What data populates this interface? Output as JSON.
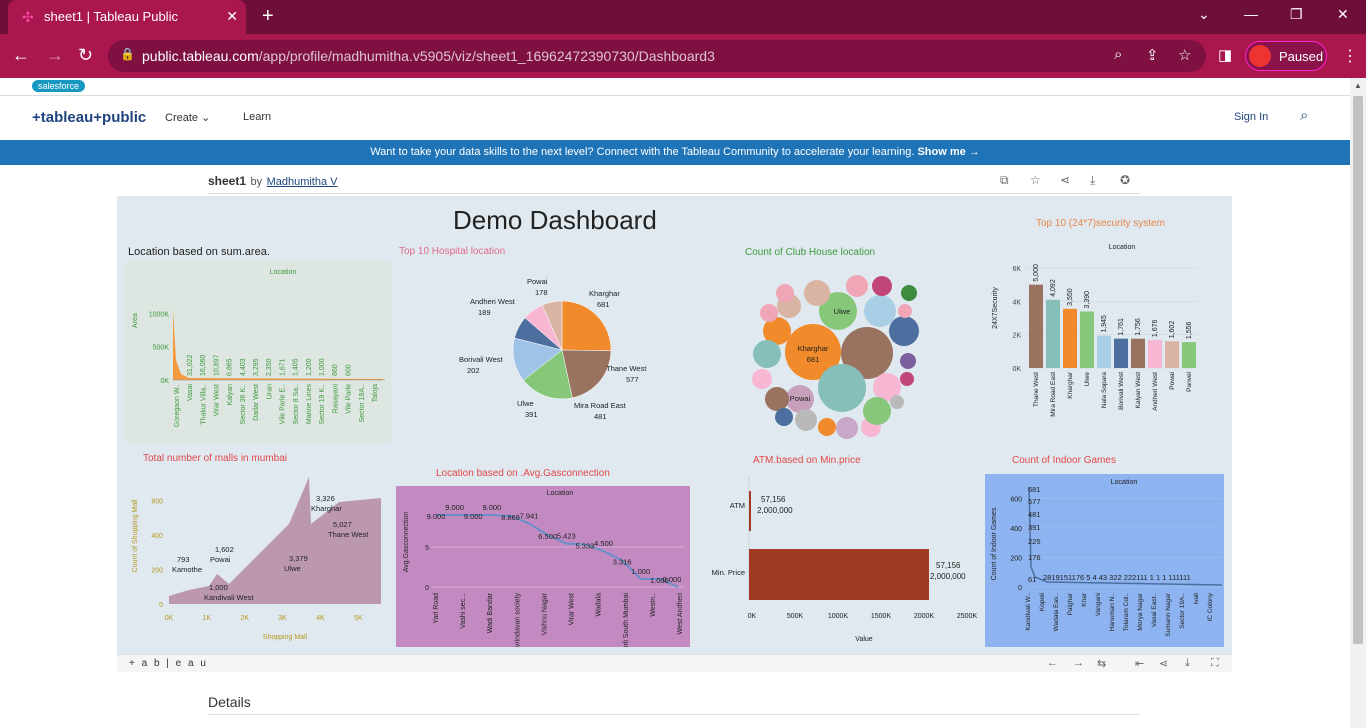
{
  "browser": {
    "tab_title": "sheet1 | Tableau Public",
    "url_host": "public.tableau.com",
    "url_path": "/app/profile/madhumitha.v5905/viz/sheet1_16962472390730/Dashboard3",
    "profile_label": "Paused",
    "bookmark": "salesforce"
  },
  "site": {
    "logo": "+tableau+public",
    "nav": [
      "Create",
      "Learn"
    ],
    "signin": "Sign In",
    "banner_text": "Want to take your data skills to the next level? Connect with the Tableau Community to accelerate your learning. ",
    "banner_link": "Show me →"
  },
  "viz": {
    "sheet_name": "sheet1",
    "by": "by",
    "author": "Madhumitha V",
    "footer_logo": "+ a b | e a u",
    "details": "Details"
  },
  "dashboard": {
    "title": "Demo Dashboard",
    "titles": {
      "area": "Location based on sum.area.",
      "hospital": "Top 10 Hospital location",
      "club": "Count of Club House location",
      "security": "Top 10 (24*7)security system",
      "malls": "Total number of malls in mumbai",
      "gas": "Location based on .Avg.Gasconnection",
      "atm": "ATM.based on Min.price",
      "indoor": "Count of Indoor Games"
    }
  },
  "colors": {
    "tab_bg": "#6e0f3a",
    "addr_bg": "#a9174e",
    "banner": "#1f74b8",
    "dash_bg": "#e0e9ef"
  },
  "chart_data": [
    {
      "type": "area",
      "title": "Location based on sum.area.",
      "header": "Location",
      "ylabel": "Area",
      "yticks": [
        "1000K",
        "500K",
        "0K"
      ],
      "categories": [
        "Goregaon W..",
        "Vasai",
        "Thakur Villa..",
        "Virar West",
        "Kalyan",
        "Sector 36 K..",
        "Dadar West",
        "Uran",
        "Vile Parle E..",
        "Sector 8 Sa..",
        "Marine Lines",
        "Sector 19 K..",
        "Rasayani",
        "Vile Parle",
        "Sector 19A..",
        "Taloja"
      ],
      "values": [
        31022,
        16060,
        10897,
        6865,
        4403,
        3295,
        2350,
        1671,
        1405,
        1200,
        1000,
        860,
        600
      ],
      "value_labels": [
        "31,022",
        "16,060",
        "10,897",
        "6,865",
        "4,403",
        "3,295",
        "2,350",
        "1,671",
        "1,405",
        "1,200",
        "1,000",
        "860",
        "600"
      ]
    },
    {
      "type": "pie",
      "title": "Top 10 Hospital location",
      "slices": [
        {
          "label": "Kharghar",
          "value": 681
        },
        {
          "label": "Thane West",
          "value": 577
        },
        {
          "label": "Mira Road East",
          "value": 481
        },
        {
          "label": "Ulwe",
          "value": 391
        },
        {
          "label": "Borivali West",
          "value": 202
        },
        {
          "label": "Andheri West",
          "value": 189
        },
        {
          "label": "Powai",
          "value": 178
        }
      ],
      "slice_labels": [
        {
          "name": "Kharghar",
          "val": "681"
        },
        {
          "name": "Thane West",
          "val": "577"
        },
        {
          "name": "Mira Road East",
          "val": "481"
        },
        {
          "name": "Ulwe",
          "val": "391"
        },
        {
          "name": "Borivali West",
          "val": "202"
        },
        {
          "name": "Andheri West",
          "val": "189"
        },
        {
          "name": "Powai",
          "val": "178"
        }
      ]
    },
    {
      "type": "bubble",
      "title": "Count of Club House location",
      "labels": [
        {
          "name": "Kharghar",
          "val": "681"
        },
        {
          "name": "Ulwe",
          "val": ""
        },
        {
          "name": "Powai",
          "val": ""
        }
      ]
    },
    {
      "type": "bar",
      "title": "Top 10 (24*7)security system",
      "header": "Location",
      "ylabel": "24X7Security",
      "yticks": [
        "6K",
        "4K",
        "2K",
        "0K"
      ],
      "categories": [
        "Thane West",
        "Mira Road East",
        "Kharghar",
        "Ulwe",
        "Nala Sopara",
        "Borivali West",
        "Kalyan West",
        "Andheri West",
        "Powai",
        "Panvel"
      ],
      "values": [
        5000,
        4092,
        3550,
        3390,
        1945,
        1761,
        1756,
        1676,
        1602,
        1556
      ],
      "value_labels": [
        "5,000",
        "4,092",
        "3,550",
        "3,390",
        "1,945",
        "1,761",
        "1,756",
        "1,676",
        "1,602",
        "1,556"
      ]
    },
    {
      "type": "area",
      "title": "Total number of malls in mumbai",
      "xlabel": "Shopping Mall",
      "ylabel": "Count of Shopping Mall",
      "xticks": [
        "0K",
        "1K",
        "2K",
        "3K",
        "4K",
        "5K"
      ],
      "yticks": [
        "600",
        "400",
        "200",
        "0"
      ],
      "annotations": [
        {
          "v": "793",
          "name": "Kamothe"
        },
        {
          "v": "1,602",
          "name": "Powai"
        },
        {
          "v": "1,000",
          "name": "Kandivali West"
        },
        {
          "v": "3,326",
          "name": "Kharghar"
        },
        {
          "v": "3,379",
          "name": "Ulwe"
        },
        {
          "v": "5,027",
          "name": "Thane West"
        }
      ]
    },
    {
      "type": "line",
      "title": "Location based on .Avg.Gasconnection",
      "header": "Location",
      "ylabel": "Avg.Gasconnection",
      "yticks": [
        "5",
        "0"
      ],
      "categories": [
        "Yari Road",
        "Vashi sec...",
        "Wadi Bandar",
        "vrindavan society",
        "Vishnu Nagar",
        "Virar West",
        "Wadala",
        "Worli South Mumbai",
        "Westn..",
        "West Andheri"
      ],
      "values": [
        9.0,
        9.0,
        9.0,
        9.0,
        8.869,
        7.941,
        6.5,
        5.423,
        5.333,
        4.5,
        3.316,
        1.0,
        1.0,
        0.0
      ],
      "value_labels": [
        "9.000",
        "9.000",
        "9.000",
        "9.000",
        "8.869",
        "7.941",
        "6.500",
        "5.423",
        "5.333",
        "4.500",
        "3.316",
        "1.000",
        "1.000",
        "0.000"
      ]
    },
    {
      "type": "bar",
      "title": "ATM.based on Min.price",
      "xlabel": "Value",
      "xticks": [
        "0K",
        "500K",
        "1000K",
        "1500K",
        "2000K",
        "2500K"
      ],
      "categories": [
        "ATM",
        "Min. Price"
      ],
      "labels": [
        "57,156",
        "2,000,000",
        "57,156",
        "2,000,000"
      ]
    },
    {
      "type": "line",
      "title": "Count of Indoor Games",
      "header": "Location",
      "ylabel": "Count of Indoor Games",
      "yticks": [
        "600",
        "400",
        "200",
        "0"
      ],
      "value_labels": [
        "681",
        "577",
        "481",
        "391",
        "225",
        "176",
        "61"
      ],
      "bottom_labels": "2819151176 5 4 43 322 222111 1 1 1 111111",
      "categories": [
        "Kandivali W..",
        "Kopoli",
        "Wadala Eas..",
        "Palghar",
        "Khar",
        "Vangani",
        "Hanuman N..",
        "Tolaram Col..",
        "Morya Nagar",
        "Vasai East..",
        "Sumann Nagar",
        "Sector 19A..",
        "ivali",
        "IC Colony"
      ]
    }
  ]
}
